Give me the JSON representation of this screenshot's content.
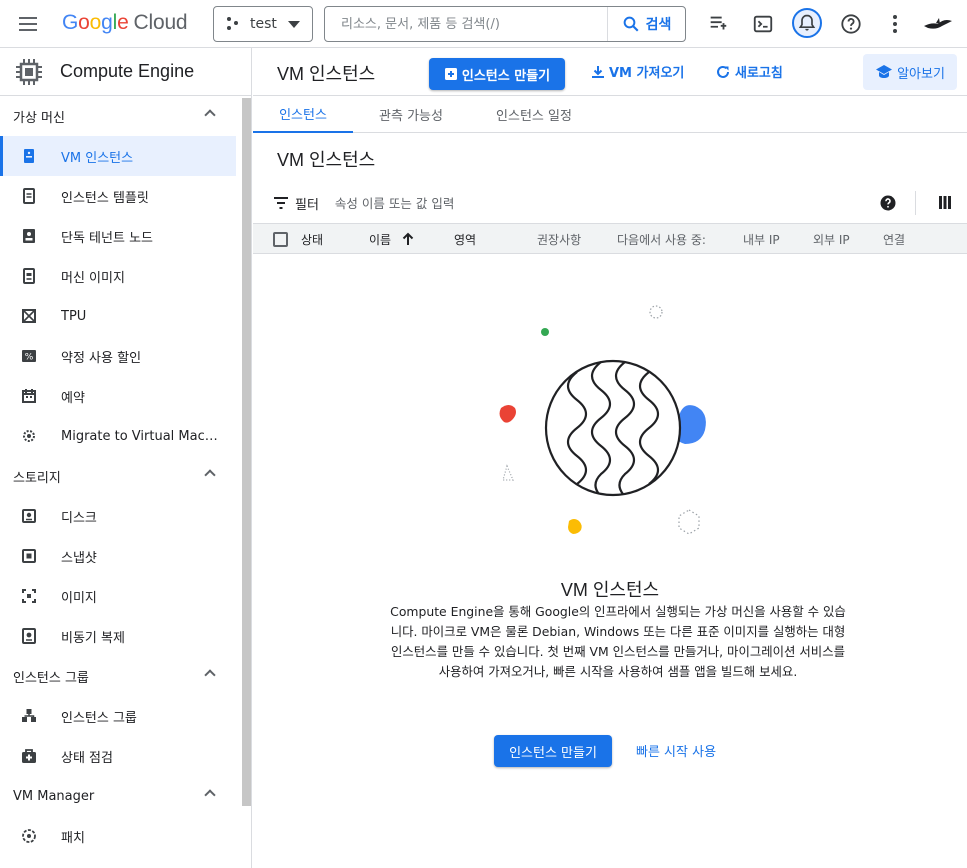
{
  "topbar": {
    "logo": {
      "g1": "G",
      "g2": "o",
      "g3": "o",
      "g4": "g",
      "g5": "l",
      "g6": "e",
      "cloud": "Cloud"
    },
    "project": "test",
    "search_placeholder": "리소스, 문서, 제품 등 검색(/)",
    "search_button": "검색"
  },
  "sidebar": {
    "product": "Compute Engine",
    "sections": [
      {
        "label": "가상 머신",
        "items": [
          {
            "label": "VM 인스턴스",
            "icon": "vm-instance-icon"
          },
          {
            "label": "인스턴스 템플릿",
            "icon": "template-icon"
          },
          {
            "label": "단독 테넌트 노드",
            "icon": "sole-tenant-icon"
          },
          {
            "label": "머신 이미지",
            "icon": "machine-image-icon"
          },
          {
            "label": "TPU",
            "icon": "tpu-icon"
          },
          {
            "label": "약정 사용 할인",
            "icon": "discount-icon"
          },
          {
            "label": "예약",
            "icon": "calendar-icon"
          },
          {
            "label": "Migrate to Virtual Machin...",
            "icon": "migrate-icon"
          }
        ]
      },
      {
        "label": "스토리지",
        "items": [
          {
            "label": "디스크",
            "icon": "disk-icon"
          },
          {
            "label": "스냅샷",
            "icon": "snapshot-icon"
          },
          {
            "label": "이미지",
            "icon": "image-icon"
          },
          {
            "label": "비동기 복제",
            "icon": "async-replication-icon"
          }
        ]
      },
      {
        "label": "인스턴스 그룹",
        "items": [
          {
            "label": "인스턴스 그룹",
            "icon": "instance-group-icon"
          },
          {
            "label": "상태 점검",
            "icon": "health-check-icon"
          }
        ]
      },
      {
        "label": "VM Manager",
        "items": [
          {
            "label": "패치",
            "icon": "patch-icon"
          }
        ]
      }
    ]
  },
  "main": {
    "title": "VM 인스턴스",
    "create_button": "인스턴스 만들기",
    "import_button": "VM 가져오기",
    "refresh_button": "새로고침",
    "learn_button": "알아보기",
    "tabs": [
      "인스턴스",
      "관측 가능성",
      "인스턴스 일정"
    ],
    "section_title": "VM 인스턴스",
    "filter_label": "필터",
    "filter_placeholder": "속성 이름 또는 값 입력",
    "columns": [
      "상태",
      "이름",
      "영역",
      "권장사항",
      "다음에서 사용 중:",
      "내부 IP",
      "외부 IP",
      "연결"
    ],
    "empty_title": "VM 인스턴스",
    "empty_desc": "Compute Engine을 통해 Google의 인프라에서 실행되는 가상 머신을 사용할 수 있습니다. 마이크로 VM은 물론 Debian, Windows 또는 다른 표준 이미지를 실행하는 대형 인스턴스를 만들 수 있습니다. 첫 번째 VM 인스턴스를 만들거나, 마이그레이션 서비스를 사용하여 가져오거나, 빠른 시작을 사용하여 샘플 앱을 빌드해 보세요.",
    "cta_create": "인스턴스 만들기",
    "cta_quickstart": "빠른 시작 사용"
  },
  "colors": {
    "accent": "#1a73e8",
    "red": "#ea4335",
    "yellow": "#fbbc04",
    "green": "#34a853"
  }
}
